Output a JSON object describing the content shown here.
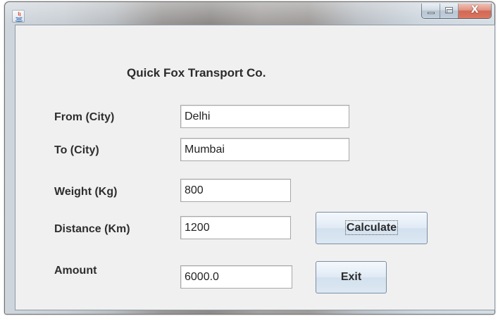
{
  "window": {
    "title": ""
  },
  "heading": "Quick Fox Transport Co.",
  "fields": {
    "from": {
      "label": "From (City)",
      "value": "Delhi"
    },
    "to": {
      "label": "To (City)",
      "value": "Mumbai"
    },
    "weight": {
      "label": "Weight (Kg)",
      "value": "800"
    },
    "distance": {
      "label": "Distance (Km)",
      "value": "1200"
    },
    "amount": {
      "label": "Amount",
      "value": "6000.0"
    }
  },
  "buttons": {
    "calculate": "Calculate",
    "exit": "Exit",
    "close_glyph": "X"
  },
  "icons": {
    "app": "java-icon",
    "minimize": "minimize-icon",
    "maximize": "maximize-icon",
    "close": "close-icon"
  },
  "colors": {
    "client_bg": "#f0f0f0",
    "button_face": "#dce8f3",
    "close_button": "#c7432a"
  }
}
